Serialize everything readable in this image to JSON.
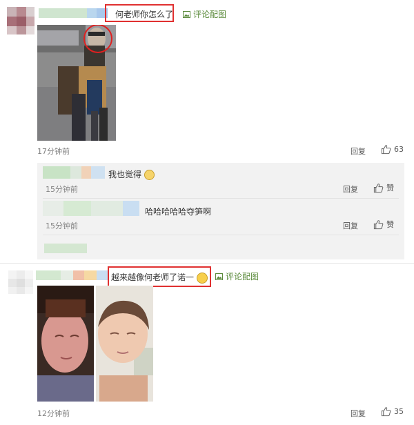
{
  "comments": [
    {
      "text": "何老师你怎么了",
      "pic_label": "评论配图",
      "time": "17分钟前",
      "reply_label": "回复",
      "like_count": "63",
      "replies": [
        {
          "text": "我也觉得",
          "time": "15分钟前",
          "reply_label": "回复",
          "like_label": "赞"
        },
        {
          "text": "哈哈哈哈哈夺笋啊",
          "time": "15分钟前",
          "reply_label": "回复",
          "like_label": "赞"
        }
      ]
    },
    {
      "text": "越来越像何老师了诺一",
      "pic_label": "评论配图",
      "time": "12分钟前",
      "reply_label": "回复",
      "like_count": "35"
    }
  ],
  "icons": {
    "image": "image-icon",
    "thumb": "thumbs-up-icon",
    "cat_emoji": "cat-emoji-icon",
    "laugh_emoji": "laughing-emoji-icon"
  },
  "colors": {
    "highlight_border": "#e03030",
    "pic_link": "#5a8a3a",
    "reply_panel": "#f2f2f2"
  }
}
